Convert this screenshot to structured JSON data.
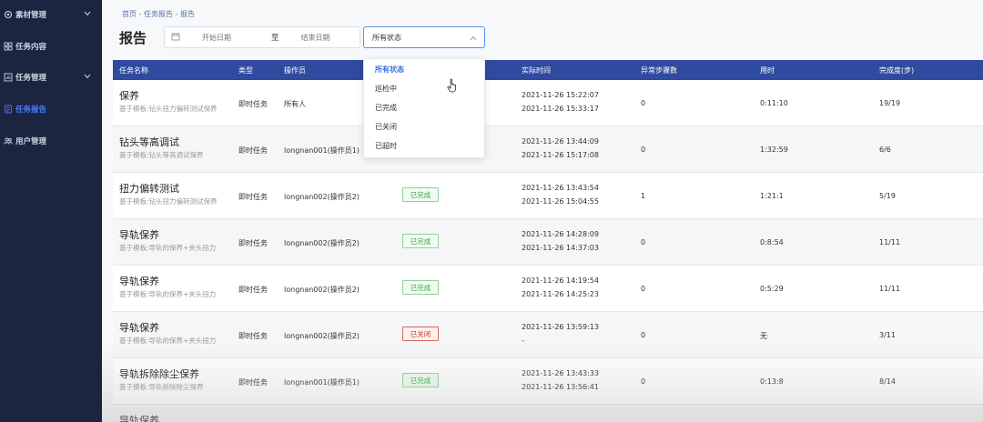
{
  "sidebar": {
    "items": [
      {
        "label": "素材管理",
        "icon": "gear-icon",
        "expandable": true
      },
      {
        "label": "任务内容",
        "icon": "grid-icon",
        "expandable": false
      },
      {
        "label": "任务管理",
        "icon": "chart-icon",
        "expandable": true
      },
      {
        "label": "任务报告",
        "icon": "report-icon",
        "expandable": false,
        "active": true
      },
      {
        "label": "用户管理",
        "icon": "users-icon",
        "expandable": false
      }
    ]
  },
  "breadcrumb": "首页 - 任务报告 - 报告",
  "page_title": "报告",
  "filters": {
    "start_placeholder": "开始日期",
    "range_separator": "至",
    "end_placeholder": "结束日期",
    "status_value": "所有状态"
  },
  "dropdown": {
    "options": [
      "所有状态",
      "巡检中",
      "已完成",
      "已关闭",
      "已超时"
    ],
    "selected": "所有状态"
  },
  "table": {
    "headers": [
      "任务名称",
      "类型",
      "操作员",
      "",
      "实际时间",
      "异常步骤数",
      "用时",
      "完成度(步)"
    ],
    "rows": [
      {
        "name": "保养",
        "sub": "基于模板:钻头扭力偏转测试保养",
        "type": "即时任务",
        "operator": "所有人",
        "status": "",
        "start": "2021-11-26 15:22:07",
        "end": "2021-11-26 15:33:17",
        "abnormal": "0",
        "duration": "0:11:10",
        "completion": "19/19"
      },
      {
        "name": "钻头等高调试",
        "sub": "基于模板:钻头等高调试保养",
        "type": "即时任务",
        "operator": "longnan001(操作员1)",
        "status": "",
        "start": "2021-11-26 13:44:09",
        "end": "2021-11-26 15:17:08",
        "abnormal": "0",
        "duration": "1:32:59",
        "completion": "6/6"
      },
      {
        "name": "扭力偏转测试",
        "sub": "基于模板:钻头扭力偏转测试保养",
        "type": "即时任务",
        "operator": "longnan002(操作员2)",
        "status": "已完成",
        "start": "2021-11-26 13:43:54",
        "end": "2021-11-26 15:04:55",
        "abnormal": "1",
        "duration": "1:21:1",
        "completion": "5/19"
      },
      {
        "name": "导轨保养",
        "sub": "基于模板:导轨的保养+夹头扭力",
        "type": "即时任务",
        "operator": "longnan002(操作员2)",
        "status": "已完成",
        "start": "2021-11-26 14:28:09",
        "end": "2021-11-26 14:37:03",
        "abnormal": "0",
        "duration": "0:8:54",
        "completion": "11/11"
      },
      {
        "name": "导轨保养",
        "sub": "基于模板:导轨的保养+夹头扭力",
        "type": "即时任务",
        "operator": "longnan002(操作员2)",
        "status": "已完成",
        "start": "2021-11-26 14:19:54",
        "end": "2021-11-26 14:25:23",
        "abnormal": "0",
        "duration": "0:5:29",
        "completion": "11/11"
      },
      {
        "name": "导轨保养",
        "sub": "基于模板:导轨的保养+夹头扭力",
        "type": "即时任务",
        "operator": "longnan002(操作员2)",
        "status": "已关闭",
        "start": "2021-11-26 13:59:13",
        "end": "-",
        "abnormal": "0",
        "duration": "无",
        "completion": "3/11"
      },
      {
        "name": "导轨拆除除尘保养",
        "sub": "基于模板:导轨拆除除尘保养",
        "type": "即时任务",
        "operator": "longnan001(操作员1)",
        "status": "已完成",
        "start": "2021-11-26 13:43:33",
        "end": "2021-11-26 13:56:41",
        "abnormal": "0",
        "duration": "0:13:8",
        "completion": "8/14"
      },
      {
        "name": "导轨保养",
        "sub": "",
        "type": "",
        "operator": "",
        "status": "",
        "start": "",
        "end": "",
        "abnormal": "",
        "duration": "",
        "completion": ""
      }
    ]
  },
  "colors": {
    "sidebar_bg": "#1b2540",
    "header_bg": "#2f4a9f",
    "accent": "#3a6fe0",
    "done": "#3aa64a",
    "closed": "#c23a2f"
  }
}
